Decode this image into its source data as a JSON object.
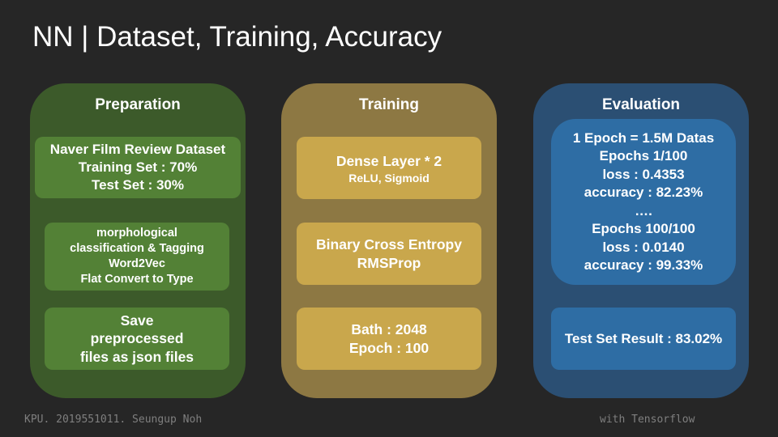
{
  "title": "NN | Dataset, Training, Accuracy",
  "preparation": {
    "heading": "Preparation",
    "box1": [
      "Naver Film Review Dataset",
      "Training Set : 70%",
      "Test Set : 30%"
    ],
    "box2": [
      "morphological",
      "classification & Tagging",
      "Word2Vec",
      "Flat Convert to Type"
    ],
    "box3": [
      "Save",
      "preprocessed",
      "files as json files"
    ]
  },
  "training": {
    "heading": "Training",
    "box1": [
      "Dense Layer * 2",
      "ReLU, Sigmoid"
    ],
    "box2": [
      "Binary Cross Entropy",
      "RMSProp"
    ],
    "box3": [
      "Bath : 2048",
      "Epoch : 100"
    ]
  },
  "evaluation": {
    "heading": "Evaluation",
    "box1": [
      "1 Epoch = 1.5M Datas",
      "Epochs 1/100",
      "loss : 0.4353",
      "accuracy : 82.23%",
      "….",
      "Epochs 100/100",
      "loss : 0.0140",
      "accuracy : 99.33%"
    ],
    "box2": "Test Set Result : 83.02%"
  },
  "footer": {
    "left": "KPU.  2019551011.  Seungup  Noh",
    "right": "with  Tensorflow"
  },
  "colors": {
    "background": "#262626",
    "prep_panel": "#3c5a2a",
    "prep_box": "#538136",
    "train_panel": "#8d7843",
    "train_box": "#c9a74c",
    "eval_panel": "#2b4f73",
    "eval_box": "#2e6da4"
  }
}
